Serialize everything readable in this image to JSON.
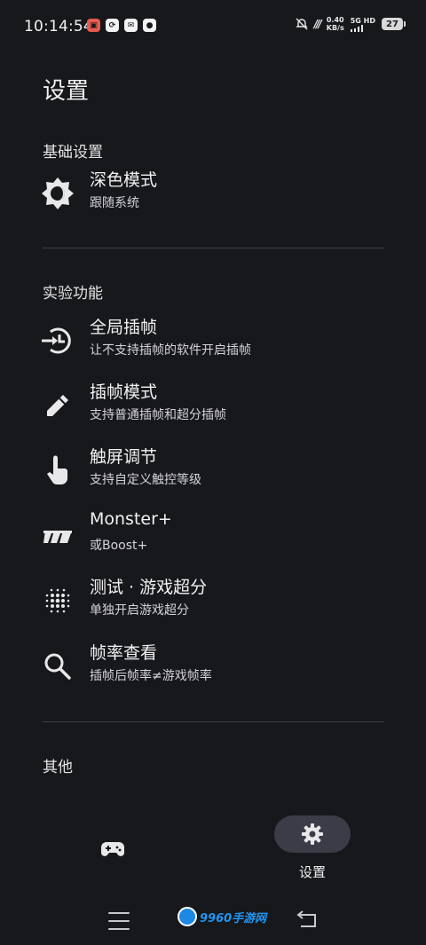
{
  "status_bar": {
    "time": "10:14:54",
    "network_speed_value": "0.40",
    "network_speed_unit": "KB/s",
    "signal_label": "5G HD",
    "battery_level": "27",
    "notification_colors": [
      "#e85a4f",
      "#f2f2f2",
      "#f2f2f2",
      "#f2f2f2"
    ]
  },
  "page": {
    "title": "设置"
  },
  "sections": {
    "basic": {
      "title": "基础设置",
      "items": [
        {
          "label": "深色模式",
          "subtitle": "跟随系统",
          "icon": "brightness-icon"
        }
      ]
    },
    "experimental": {
      "title": "实验功能",
      "items": [
        {
          "label": "全局插帧",
          "subtitle": "让不支持插帧的软件开启插帧",
          "icon": "global-frame-icon"
        },
        {
          "label": "插帧模式",
          "subtitle": "支持普通插帧和超分插帧",
          "icon": "pencil-icon"
        },
        {
          "label": "触屏调节",
          "subtitle": "支持自定义触控等级",
          "icon": "touch-icon"
        },
        {
          "label": "Monster+",
          "subtitle": "或Boost+",
          "icon": "monster-icon"
        },
        {
          "label": "测试 · 游戏超分",
          "subtitle": "单独开启游戏超分",
          "icon": "dots-grid-icon"
        },
        {
          "label": "帧率查看",
          "subtitle": "插帧后帧率≠游戏帧率",
          "icon": "search-icon"
        }
      ]
    },
    "other": {
      "title": "其他"
    }
  },
  "bottom_nav": {
    "games_icon": "gamepad-icon",
    "settings_icon": "gear-icon",
    "settings_label": "设置"
  },
  "watermark": {
    "text": "9960手游网"
  },
  "colors": {
    "background": "#17181c",
    "divider": "#3e3f45",
    "nav_pill": "#3b3c48",
    "text": "#f2f2f4"
  }
}
